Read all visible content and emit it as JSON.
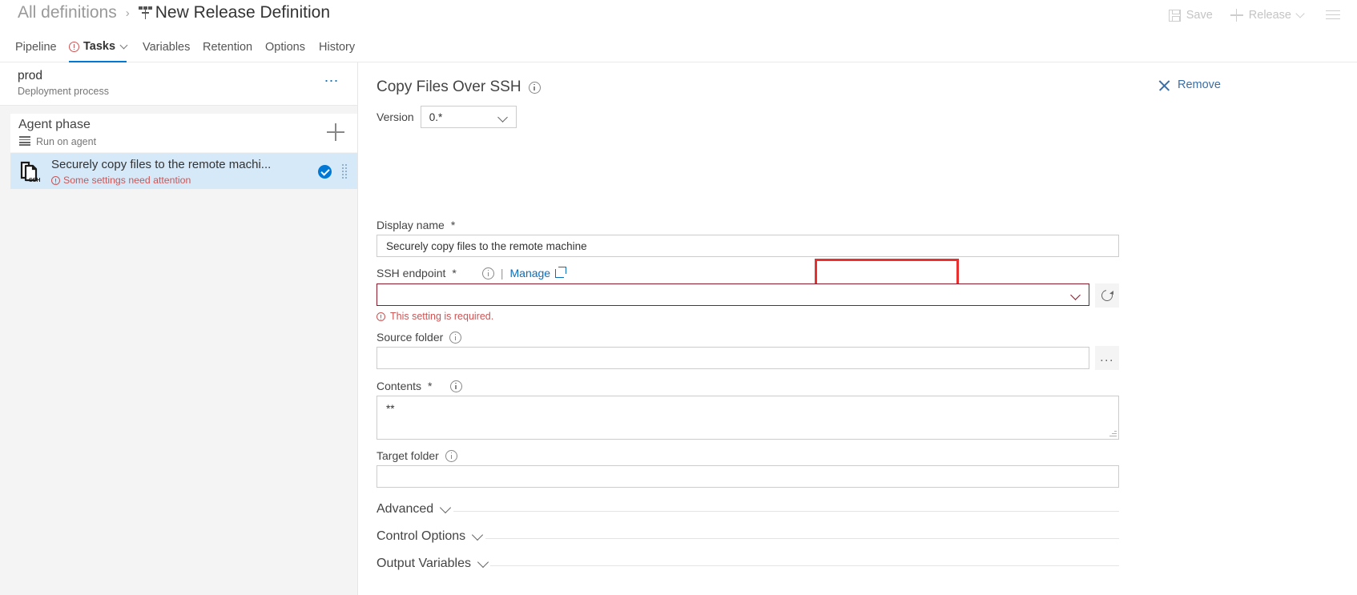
{
  "breadcrumb": {
    "root": "All definitions",
    "separator": "›",
    "title": "New Release Definition",
    "icon": "release-definition-icon"
  },
  "topbar_actions": {
    "save": {
      "label": "Save",
      "icon": "save-icon",
      "enabled": false
    },
    "release": {
      "label": "Release",
      "icon": "plus-icon",
      "enabled": false
    },
    "menu_icon": "hamburger-icon"
  },
  "tabs": [
    {
      "label": "Pipeline",
      "active": false,
      "warning": false
    },
    {
      "label": "Tasks",
      "active": true,
      "warning": true,
      "has_chevron": true
    },
    {
      "label": "Variables",
      "active": false,
      "warning": false
    },
    {
      "label": "Retention",
      "active": false,
      "warning": false
    },
    {
      "label": "Options",
      "active": false,
      "warning": false
    },
    {
      "label": "History",
      "active": false,
      "warning": false
    }
  ],
  "left_panel": {
    "process": {
      "name": "prod",
      "subtitle": "Deployment process",
      "overflow_icon": "ellipsis-icon"
    },
    "phase": {
      "name": "Agent phase",
      "subtitle": "Run on agent",
      "subtitle_icon": "agent-queue-icon",
      "add_icon": "plus-icon"
    },
    "tasks": [
      {
        "title": "Securely copy files to the remote machi...",
        "warning": "Some settings need attention",
        "icon": "copy-files-ssh-icon",
        "icon_badge": "SSH",
        "status_icon": "check-circle-icon",
        "grip_icon": "drag-handle-icon",
        "selected": true
      }
    ]
  },
  "main_panel": {
    "task_title": "Copy Files Over SSH",
    "task_title_info_icon": "info-icon",
    "version": {
      "label": "Version",
      "value": "0.*",
      "chevron_icon": "chevron-down-icon"
    },
    "remove_button": {
      "label": "Remove",
      "icon": "close-x-icon"
    },
    "fields": [
      {
        "label": "Display name",
        "required": true,
        "value": "Securely copy files to the remote machine",
        "type": "text"
      },
      {
        "label": "SSH endpoint",
        "required": true,
        "value": "",
        "type": "dropdown",
        "info_icon": "info-icon",
        "separator": "|",
        "manage_link": "Manage",
        "manage_icon": "external-link-icon",
        "refresh_icon": "refresh-icon",
        "error": "This setting is required.",
        "error_icon": "warning-circle-icon",
        "highlighted": true
      },
      {
        "label": "Source folder",
        "required": false,
        "value": "",
        "type": "text",
        "info_icon": "info-icon",
        "browse_icon": "ellipsis-icon",
        "browse_label": "..."
      },
      {
        "label": "Contents",
        "required": true,
        "value": "**",
        "type": "textarea",
        "info_icon": "info-icon"
      },
      {
        "label": "Target folder",
        "required": false,
        "value": "",
        "type": "text",
        "info_icon": "info-icon"
      }
    ],
    "sections": [
      {
        "label": "Advanced",
        "expanded": false,
        "chevron_icon": "chevron-down-icon"
      },
      {
        "label": "Control Options",
        "expanded": false,
        "chevron_icon": "chevron-down-icon"
      },
      {
        "label": "Output Variables",
        "expanded": false,
        "chevron_icon": "chevron-down-icon"
      }
    ]
  },
  "colors": {
    "accent": "#0078d4",
    "link": "#0a6ebd",
    "error": "#cc5555",
    "error_border": "#8b1a2b",
    "annotation": "#e83030",
    "selected_row": "#d6e9f8"
  }
}
